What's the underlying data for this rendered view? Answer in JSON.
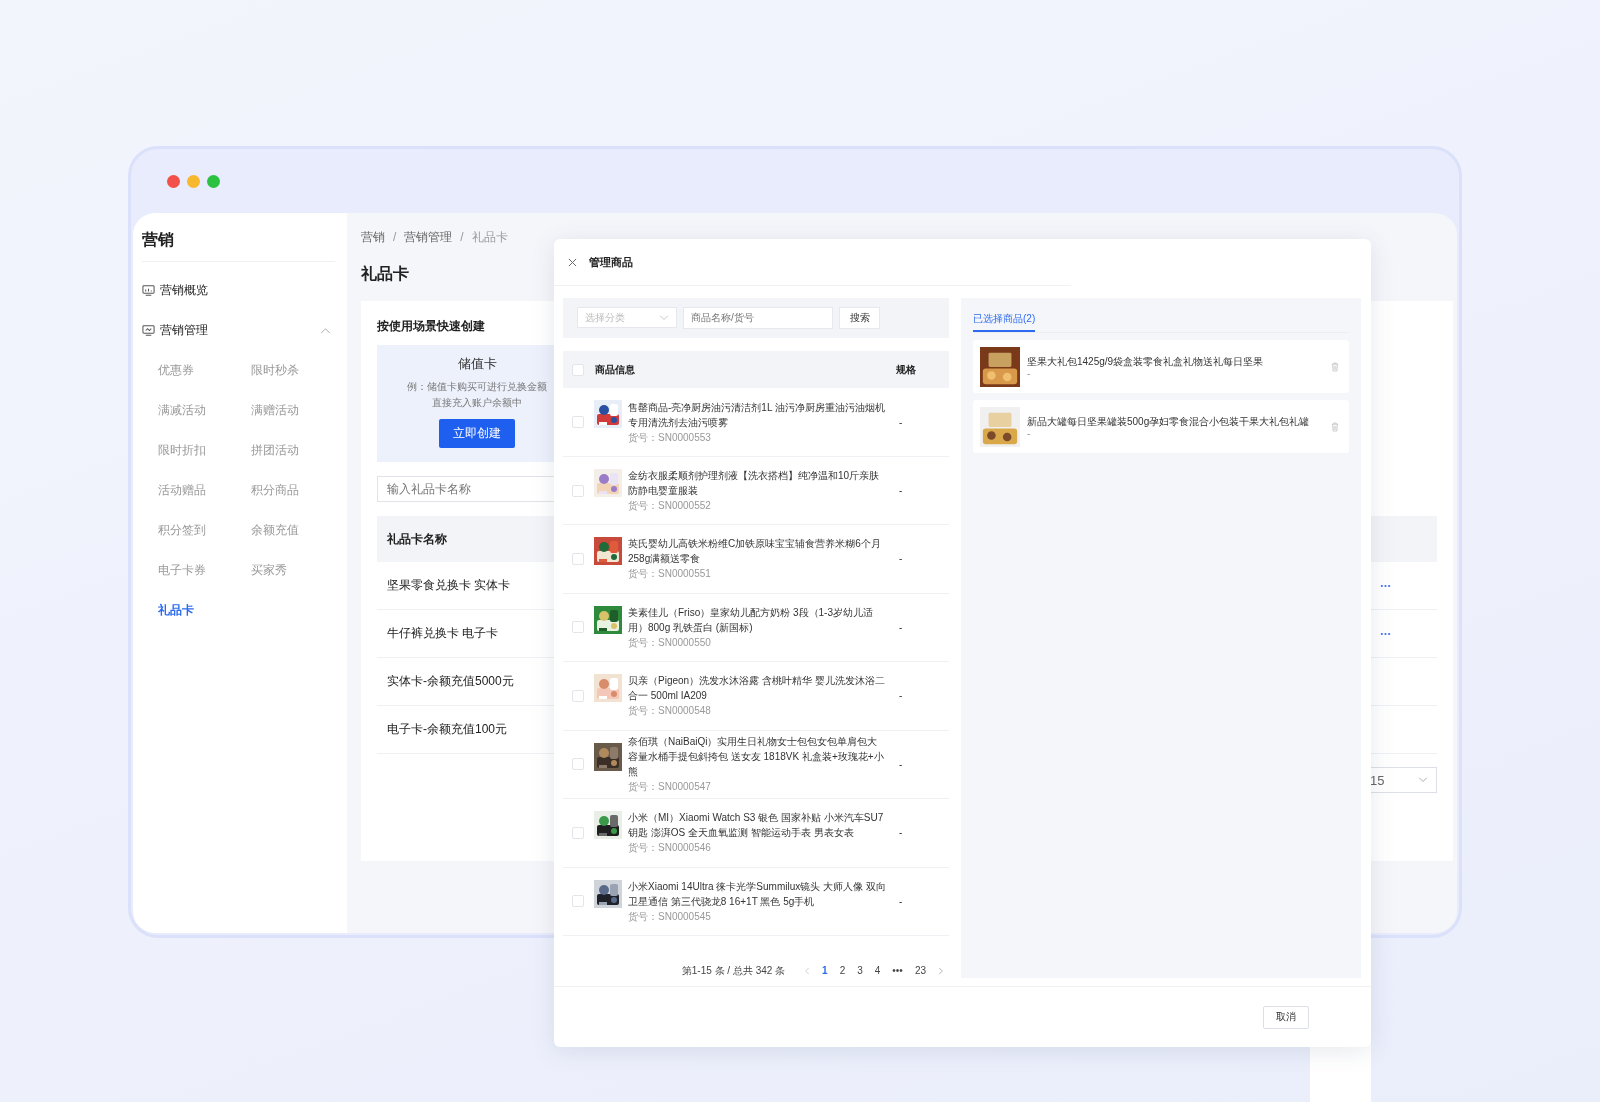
{
  "sidebar": {
    "title": "营销",
    "items": [
      {
        "label": "营销概览",
        "kind": "link"
      },
      {
        "label": "营销管理",
        "kind": "group",
        "expanded": true,
        "children": [
          {
            "label": "优惠券",
            "selected": false
          },
          {
            "label": "限时秒杀",
            "selected": false
          },
          {
            "label": "满减活动",
            "selected": false
          },
          {
            "label": "满赠活动",
            "selected": false
          },
          {
            "label": "限时折扣",
            "selected": false
          },
          {
            "label": "拼团活动",
            "selected": false
          },
          {
            "label": "活动赠品",
            "selected": false
          },
          {
            "label": "积分商品",
            "selected": false
          },
          {
            "label": "积分签到",
            "selected": false
          },
          {
            "label": "余额充值",
            "selected": false
          },
          {
            "label": "电子卡券",
            "selected": false
          },
          {
            "label": "买家秀",
            "selected": false
          },
          {
            "label": "礼品卡",
            "selected": true
          }
        ]
      }
    ]
  },
  "breadcrumb": [
    "营销",
    "营销管理",
    "礼品卡"
  ],
  "breadcrumb_separator": "/",
  "page_title": "礼品卡",
  "quick_create": {
    "title": "按使用场景快速创建",
    "card": {
      "title": "储值卡",
      "description": "例：储值卡购买可进行兑换金额直接充入账户余额中",
      "button": "立即创建"
    }
  },
  "search": {
    "placeholder": "输入礼品卡名称"
  },
  "table": {
    "columns": [
      "礼品卡名称"
    ],
    "rows": [
      {
        "name": "坚果零食兑换卡 实体卡",
        "more_menu": true
      },
      {
        "name": "牛仔裤兑换卡 电子卡",
        "more_menu": true
      },
      {
        "name": "实体卡-余额充值5000元",
        "more_menu": false
      },
      {
        "name": "电子卡-余额充值100元",
        "more_menu": false
      }
    ]
  },
  "page_size": "15",
  "modal": {
    "title": "管理商品",
    "filter": {
      "category_placeholder": "选择分类",
      "search_placeholder": "商品名称/货号",
      "search_button": "搜索"
    },
    "columns": [
      "商品信息",
      "规格"
    ],
    "select_all": {
      "checked": false
    },
    "products": [
      {
        "name": "售罄商品-亮净厨房油污清洁剂1L 油污净厨房重油污油烟机专用清洗剂去油污喷雾",
        "sku": "货号：SN0000553",
        "spec": "-",
        "checked": false
      },
      {
        "name": "金纺衣服柔顺剂护理剂液【洗衣搭档】纯净温和10斤亲肤防静电婴童服装",
        "sku": "货号：SN0000552",
        "spec": "-",
        "checked": false
      },
      {
        "name": "英氏婴幼儿高铁米粉维C加铁原味宝宝辅食营养米糊6个月258g满额送零食",
        "sku": "货号：SN0000551",
        "spec": "-",
        "checked": false
      },
      {
        "name": "美素佳儿（Friso）皇家幼儿配方奶粉 3段（1-3岁幼儿适用）800g 乳铁蛋白 (新国标)",
        "sku": "货号：SN0000550",
        "spec": "-",
        "checked": false
      },
      {
        "name": "贝亲（Pigeon）洗发水沐浴露 含桃叶精华 婴儿洗发沐浴二合一 500ml IA209",
        "sku": "货号：SN0000548",
        "spec": "-",
        "checked": false
      },
      {
        "name": "奈佰琪（NaiBaiQi）实用生日礼物女士包包女包单肩包大容量水桶手提包斜挎包 送女友 1818VK 礼盒装+玫瑰花+小熊",
        "sku": "货号：SN0000547",
        "spec": "-",
        "checked": false
      },
      {
        "name": "小米（MI）Xiaomi Watch S3 银色 国家补贴 小米汽车SU7钥匙 澎湃OS 全天血氧监测 智能运动手表 男表女表",
        "sku": "货号：SN0000546",
        "spec": "-",
        "checked": false
      },
      {
        "name": "小米Xiaomi 14Ultra 徕卡光学Summilux镜头 大师人像 双向卫星通信 第三代骁龙8 16+1T 黑色 5g手机",
        "sku": "货号：SN0000545",
        "spec": "-",
        "checked": false
      }
    ],
    "pagination": {
      "summary": "第1-15 条 / 总共 342 条",
      "pages": [
        {
          "label": "1",
          "selected": true
        },
        {
          "label": "2",
          "selected": false
        },
        {
          "label": "3",
          "selected": false
        },
        {
          "label": "4",
          "selected": false
        },
        {
          "label": "•••",
          "selected": false
        },
        {
          "label": "23",
          "selected": false
        }
      ]
    },
    "selected_tab": {
      "label": "已选择商品(2)",
      "selected": true
    },
    "selected_items": [
      {
        "name": "坚果大礼包1425g/9袋盒装零食礼盒礼物送礼每日坚果",
        "spec": "-"
      },
      {
        "name": "新品大罐每日坚果罐装500g孕妇零食混合小包装干果大礼包礼罐",
        "spec": "-"
      }
    ],
    "cancel_button": "取消"
  }
}
